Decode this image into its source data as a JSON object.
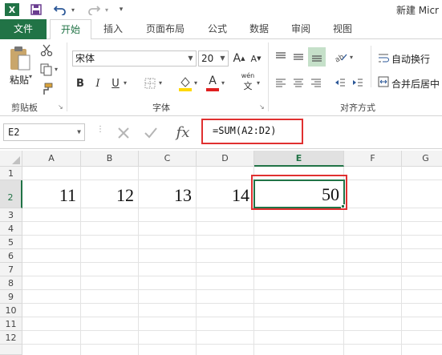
{
  "title_bar": {
    "app_icon": "X",
    "title": "新建 Micr"
  },
  "tabs": [
    "文件",
    "开始",
    "插入",
    "页面布局",
    "公式",
    "数据",
    "审阅",
    "视图"
  ],
  "ribbon": {
    "clipboard": {
      "paste_label": "粘贴",
      "group_label": "剪贴板"
    },
    "font": {
      "name": "宋体",
      "size": "20",
      "grow": "A",
      "shrink": "A",
      "bold": "B",
      "italic": "I",
      "underline": "U",
      "color_letter": "A",
      "wen_label": "wén",
      "group_label": "字体"
    },
    "alignment": {
      "wrap_text": "自动换行",
      "merge_center": "合并后居中",
      "group_label": "对齐方式"
    }
  },
  "formula_bar": {
    "name_box": "E2",
    "fx": "fx",
    "formula": "=SUM(A2:D2)"
  },
  "grid": {
    "columns": [
      "A",
      "B",
      "C",
      "D",
      "E",
      "F",
      "G"
    ],
    "rows": [
      "1",
      "2",
      "3",
      "4",
      "5",
      "6",
      "7",
      "8",
      "9",
      "10",
      "11",
      "12"
    ],
    "row2": [
      "11",
      "12",
      "13",
      "14",
      "50"
    ],
    "active_cell": "E2"
  },
  "colors": {
    "accent": "#217346",
    "highlight_box": "#e03030"
  }
}
